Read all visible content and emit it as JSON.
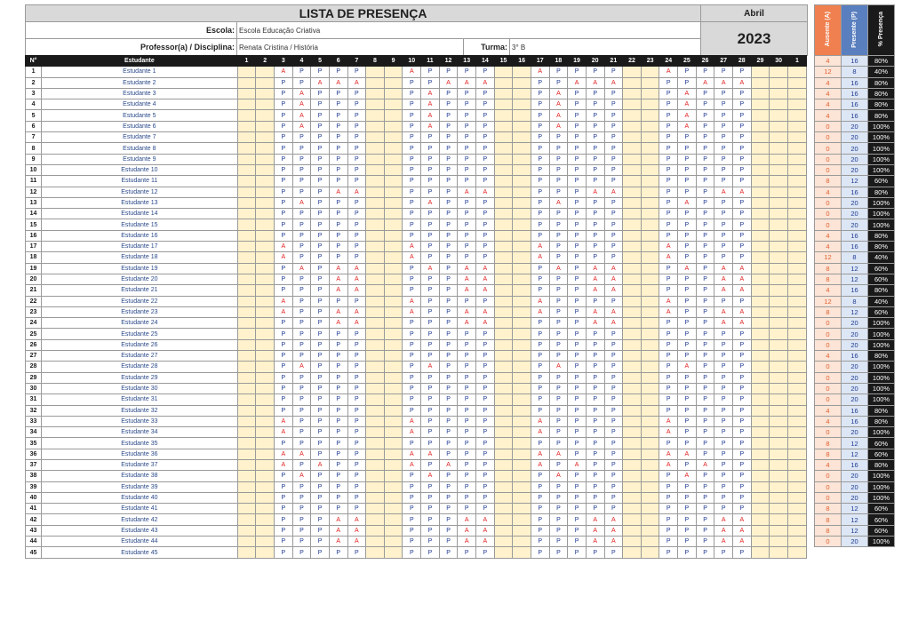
{
  "header": {
    "title": "LISTA DE PRESENÇA",
    "month": "Abril",
    "year": "2023",
    "school_label": "Escola:",
    "school_value": "Escola Educação Criativa",
    "teacher_label": "Professor(a) / Disciplina:",
    "teacher_value": "Renata Cristina / História",
    "class_label": "Turma:",
    "class_value": "3° B"
  },
  "columns": {
    "num": "N°",
    "student": "Estudante",
    "days": [
      "1",
      "2",
      "3",
      "4",
      "5",
      "6",
      "7",
      "8",
      "9",
      "10",
      "11",
      "12",
      "13",
      "14",
      "15",
      "16",
      "17",
      "18",
      "19",
      "20",
      "21",
      "22",
      "23",
      "24",
      "25",
      "26",
      "27",
      "28",
      "29",
      "30",
      "1"
    ],
    "absent": "Ausente (A)",
    "present": "Presente (P)",
    "percent": "% Presença"
  },
  "attendance_day_columns": [
    3,
    4,
    5,
    6,
    7,
    10,
    11,
    12,
    13,
    14,
    17,
    18,
    19,
    20,
    21,
    24,
    25,
    26,
    27,
    28
  ],
  "students": [
    {
      "n": "1",
      "name": "Estudante 1",
      "week": "APPPP",
      "absent": "4",
      "present": "16",
      "percent": "80%"
    },
    {
      "n": "2",
      "name": "Estudante 2",
      "week": "PPAAA",
      "absent": "12",
      "present": "8",
      "percent": "40%"
    },
    {
      "n": "3",
      "name": "Estudante 3",
      "week": "PAPPP",
      "absent": "4",
      "present": "16",
      "percent": "80%"
    },
    {
      "n": "4",
      "name": "Estudante 4",
      "week": "PAPPP",
      "absent": "4",
      "present": "16",
      "percent": "80%"
    },
    {
      "n": "5",
      "name": "Estudante 5",
      "week": "PAPPP",
      "absent": "4",
      "present": "16",
      "percent": "80%"
    },
    {
      "n": "6",
      "name": "Estudante 6",
      "week": "PAPPP",
      "absent": "4",
      "present": "16",
      "percent": "80%"
    },
    {
      "n": "7",
      "name": "Estudante 7",
      "week": "PPPPP",
      "absent": "0",
      "present": "20",
      "percent": "100%"
    },
    {
      "n": "8",
      "name": "Estudante 8",
      "week": "PPPPP",
      "absent": "0",
      "present": "20",
      "percent": "100%"
    },
    {
      "n": "9",
      "name": "Estudante 9",
      "week": "PPPPP",
      "absent": "0",
      "present": "20",
      "percent": "100%"
    },
    {
      "n": "10",
      "name": "Estudante 10",
      "week": "PPPPP",
      "absent": "0",
      "present": "20",
      "percent": "100%"
    },
    {
      "n": "11",
      "name": "Estudante 11",
      "week": "PPPPP",
      "absent": "0",
      "present": "20",
      "percent": "100%"
    },
    {
      "n": "12",
      "name": "Estudante 12",
      "week": "PPPAA",
      "absent": "8",
      "present": "12",
      "percent": "60%"
    },
    {
      "n": "13",
      "name": "Estudante 13",
      "week": "PAPPP",
      "absent": "4",
      "present": "16",
      "percent": "80%"
    },
    {
      "n": "14",
      "name": "Estudante 14",
      "week": "PPPPP",
      "absent": "0",
      "present": "20",
      "percent": "100%"
    },
    {
      "n": "15",
      "name": "Estudante 15",
      "week": "PPPPP",
      "absent": "0",
      "present": "20",
      "percent": "100%"
    },
    {
      "n": "16",
      "name": "Estudante 16",
      "week": "PPPPP",
      "absent": "0",
      "present": "20",
      "percent": "100%"
    },
    {
      "n": "17",
      "name": "Estudante 17",
      "week": "APPPP",
      "absent": "4",
      "present": "16",
      "percent": "80%"
    },
    {
      "n": "18",
      "name": "Estudante 18",
      "week": "APPPP",
      "absent": "4",
      "present": "16",
      "percent": "80%"
    },
    {
      "n": "19",
      "name": "Estudante 19",
      "week": "PAPAA",
      "absent": "12",
      "present": "8",
      "percent": "40%"
    },
    {
      "n": "20",
      "name": "Estudante 20",
      "week": "PPPAA",
      "absent": "8",
      "present": "12",
      "percent": "60%"
    },
    {
      "n": "21",
      "name": "Estudante 21",
      "week": "PPPAA",
      "absent": "8",
      "present": "12",
      "percent": "60%"
    },
    {
      "n": "22",
      "name": "Estudante 22",
      "week": "APPPP",
      "absent": "4",
      "present": "16",
      "percent": "80%"
    },
    {
      "n": "23",
      "name": "Estudante 23",
      "week": "APPAA",
      "absent": "12",
      "present": "8",
      "percent": "40%"
    },
    {
      "n": "24",
      "name": "Estudante 24",
      "week": "PPPAA",
      "absent": "8",
      "present": "12",
      "percent": "60%"
    },
    {
      "n": "25",
      "name": "Estudante 25",
      "week": "PPPPP",
      "absent": "0",
      "present": "20",
      "percent": "100%"
    },
    {
      "n": "26",
      "name": "Estudante 26",
      "week": "PPPPP",
      "absent": "0",
      "present": "20",
      "percent": "100%"
    },
    {
      "n": "27",
      "name": "Estudante 27",
      "week": "PPPPP",
      "absent": "0",
      "present": "20",
      "percent": "100%"
    },
    {
      "n": "28",
      "name": "Estudante 28",
      "week": "PAPPP",
      "absent": "4",
      "present": "16",
      "percent": "80%"
    },
    {
      "n": "29",
      "name": "Estudante 29",
      "week": "PPPPP",
      "absent": "0",
      "present": "20",
      "percent": "100%"
    },
    {
      "n": "30",
      "name": "Estudante 30",
      "week": "PPPPP",
      "absent": "0",
      "present": "20",
      "percent": "100%"
    },
    {
      "n": "31",
      "name": "Estudante 31",
      "week": "PPPPP",
      "absent": "0",
      "present": "20",
      "percent": "100%"
    },
    {
      "n": "32",
      "name": "Estudante 32",
      "week": "PPPPP",
      "absent": "0",
      "present": "20",
      "percent": "100%"
    },
    {
      "n": "33",
      "name": "Estudante 33",
      "week": "APPPP",
      "absent": "4",
      "present": "16",
      "percent": "80%"
    },
    {
      "n": "34",
      "name": "Estudante 34",
      "week": "APPPP",
      "absent": "4",
      "present": "16",
      "percent": "80%"
    },
    {
      "n": "35",
      "name": "Estudante 35",
      "week": "PPPPP",
      "absent": "0",
      "present": "20",
      "percent": "100%"
    },
    {
      "n": "36",
      "name": "Estudante 36",
      "week": "AAPPP",
      "absent": "8",
      "present": "12",
      "percent": "60%"
    },
    {
      "n": "37",
      "name": "Estudante 37",
      "week": "APAPP",
      "absent": "8",
      "present": "12",
      "percent": "60%"
    },
    {
      "n": "38",
      "name": "Estudante 38",
      "week": "PAPPP",
      "absent": "4",
      "present": "16",
      "percent": "80%"
    },
    {
      "n": "39",
      "name": "Estudante 39",
      "week": "PPPPP",
      "absent": "0",
      "present": "20",
      "percent": "100%"
    },
    {
      "n": "40",
      "name": "Estudante 40",
      "week": "PPPPP",
      "absent": "0",
      "present": "20",
      "percent": "100%"
    },
    {
      "n": "41",
      "name": "Estudante 41",
      "week": "PPPPP",
      "absent": "0",
      "present": "20",
      "percent": "100%"
    },
    {
      "n": "42",
      "name": "Estudante 42",
      "week": "PPPAA",
      "absent": "8",
      "present": "12",
      "percent": "60%"
    },
    {
      "n": "43",
      "name": "Estudante 43",
      "week": "PPPAA",
      "absent": "8",
      "present": "12",
      "percent": "60%"
    },
    {
      "n": "44",
      "name": "Estudante 44",
      "week": "PPPAA",
      "absent": "8",
      "present": "12",
      "percent": "60%"
    },
    {
      "n": "45",
      "name": "Estudante 45",
      "week": "PPPPP",
      "absent": "0",
      "present": "20",
      "percent": "100%"
    }
  ],
  "colors": {
    "weekday_fill": "#fff2cc",
    "present_text": "#1f3a93",
    "absent_text": "#e02020",
    "header_bar": "#1a1a1a",
    "absent_column": "#fce4d6",
    "present_column": "#dce6f4"
  }
}
